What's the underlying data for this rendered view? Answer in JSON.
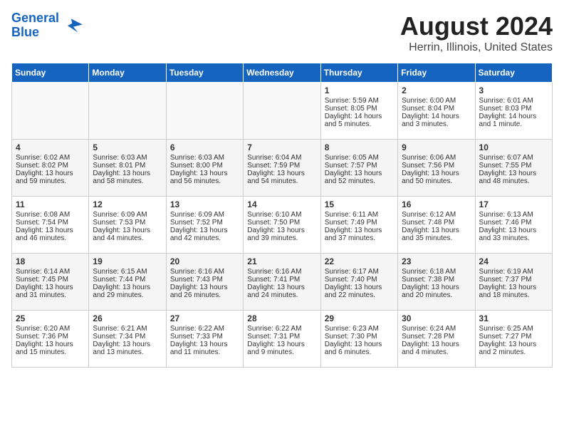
{
  "header": {
    "logo_line1": "General",
    "logo_line2": "Blue",
    "month_year": "August 2024",
    "location": "Herrin, Illinois, United States"
  },
  "days_of_week": [
    "Sunday",
    "Monday",
    "Tuesday",
    "Wednesday",
    "Thursday",
    "Friday",
    "Saturday"
  ],
  "weeks": [
    [
      {
        "day": "",
        "info": ""
      },
      {
        "day": "",
        "info": ""
      },
      {
        "day": "",
        "info": ""
      },
      {
        "day": "",
        "info": ""
      },
      {
        "day": "1",
        "info": "Sunrise: 5:59 AM\nSunset: 8:05 PM\nDaylight: 14 hours\nand 5 minutes."
      },
      {
        "day": "2",
        "info": "Sunrise: 6:00 AM\nSunset: 8:04 PM\nDaylight: 14 hours\nand 3 minutes."
      },
      {
        "day": "3",
        "info": "Sunrise: 6:01 AM\nSunset: 8:03 PM\nDaylight: 14 hours\nand 1 minute."
      }
    ],
    [
      {
        "day": "4",
        "info": "Sunrise: 6:02 AM\nSunset: 8:02 PM\nDaylight: 13 hours\nand 59 minutes."
      },
      {
        "day": "5",
        "info": "Sunrise: 6:03 AM\nSunset: 8:01 PM\nDaylight: 13 hours\nand 58 minutes."
      },
      {
        "day": "6",
        "info": "Sunrise: 6:03 AM\nSunset: 8:00 PM\nDaylight: 13 hours\nand 56 minutes."
      },
      {
        "day": "7",
        "info": "Sunrise: 6:04 AM\nSunset: 7:59 PM\nDaylight: 13 hours\nand 54 minutes."
      },
      {
        "day": "8",
        "info": "Sunrise: 6:05 AM\nSunset: 7:57 PM\nDaylight: 13 hours\nand 52 minutes."
      },
      {
        "day": "9",
        "info": "Sunrise: 6:06 AM\nSunset: 7:56 PM\nDaylight: 13 hours\nand 50 minutes."
      },
      {
        "day": "10",
        "info": "Sunrise: 6:07 AM\nSunset: 7:55 PM\nDaylight: 13 hours\nand 48 minutes."
      }
    ],
    [
      {
        "day": "11",
        "info": "Sunrise: 6:08 AM\nSunset: 7:54 PM\nDaylight: 13 hours\nand 46 minutes."
      },
      {
        "day": "12",
        "info": "Sunrise: 6:09 AM\nSunset: 7:53 PM\nDaylight: 13 hours\nand 44 minutes."
      },
      {
        "day": "13",
        "info": "Sunrise: 6:09 AM\nSunset: 7:52 PM\nDaylight: 13 hours\nand 42 minutes."
      },
      {
        "day": "14",
        "info": "Sunrise: 6:10 AM\nSunset: 7:50 PM\nDaylight: 13 hours\nand 39 minutes."
      },
      {
        "day": "15",
        "info": "Sunrise: 6:11 AM\nSunset: 7:49 PM\nDaylight: 13 hours\nand 37 minutes."
      },
      {
        "day": "16",
        "info": "Sunrise: 6:12 AM\nSunset: 7:48 PM\nDaylight: 13 hours\nand 35 minutes."
      },
      {
        "day": "17",
        "info": "Sunrise: 6:13 AM\nSunset: 7:46 PM\nDaylight: 13 hours\nand 33 minutes."
      }
    ],
    [
      {
        "day": "18",
        "info": "Sunrise: 6:14 AM\nSunset: 7:45 PM\nDaylight: 13 hours\nand 31 minutes."
      },
      {
        "day": "19",
        "info": "Sunrise: 6:15 AM\nSunset: 7:44 PM\nDaylight: 13 hours\nand 29 minutes."
      },
      {
        "day": "20",
        "info": "Sunrise: 6:16 AM\nSunset: 7:43 PM\nDaylight: 13 hours\nand 26 minutes."
      },
      {
        "day": "21",
        "info": "Sunrise: 6:16 AM\nSunset: 7:41 PM\nDaylight: 13 hours\nand 24 minutes."
      },
      {
        "day": "22",
        "info": "Sunrise: 6:17 AM\nSunset: 7:40 PM\nDaylight: 13 hours\nand 22 minutes."
      },
      {
        "day": "23",
        "info": "Sunrise: 6:18 AM\nSunset: 7:38 PM\nDaylight: 13 hours\nand 20 minutes."
      },
      {
        "day": "24",
        "info": "Sunrise: 6:19 AM\nSunset: 7:37 PM\nDaylight: 13 hours\nand 18 minutes."
      }
    ],
    [
      {
        "day": "25",
        "info": "Sunrise: 6:20 AM\nSunset: 7:36 PM\nDaylight: 13 hours\nand 15 minutes."
      },
      {
        "day": "26",
        "info": "Sunrise: 6:21 AM\nSunset: 7:34 PM\nDaylight: 13 hours\nand 13 minutes."
      },
      {
        "day": "27",
        "info": "Sunrise: 6:22 AM\nSunset: 7:33 PM\nDaylight: 13 hours\nand 11 minutes."
      },
      {
        "day": "28",
        "info": "Sunrise: 6:22 AM\nSunset: 7:31 PM\nDaylight: 13 hours\nand 9 minutes."
      },
      {
        "day": "29",
        "info": "Sunrise: 6:23 AM\nSunset: 7:30 PM\nDaylight: 13 hours\nand 6 minutes."
      },
      {
        "day": "30",
        "info": "Sunrise: 6:24 AM\nSunset: 7:28 PM\nDaylight: 13 hours\nand 4 minutes."
      },
      {
        "day": "31",
        "info": "Sunrise: 6:25 AM\nSunset: 7:27 PM\nDaylight: 13 hours\nand 2 minutes."
      }
    ]
  ]
}
